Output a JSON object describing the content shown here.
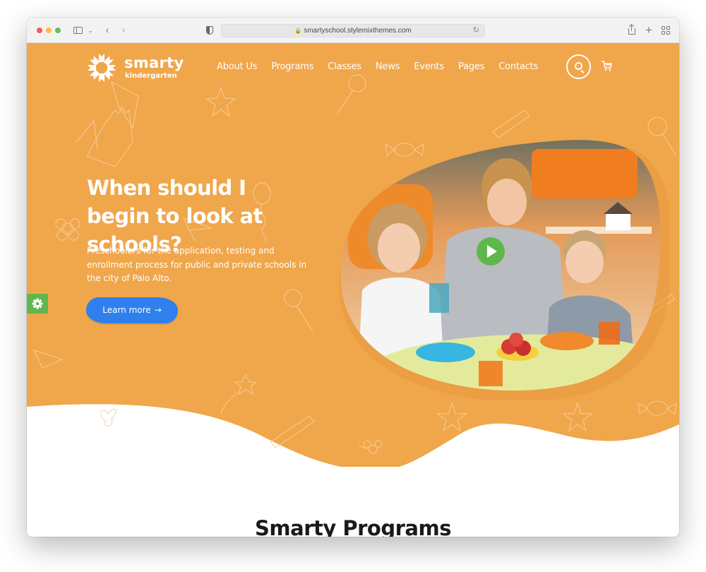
{
  "browser": {
    "url": "smartyschool.stylemixthemes.com",
    "icons": [
      "sidebar-icon",
      "chevron-down-icon",
      "back-icon",
      "forward-icon",
      "privacy-shield-icon",
      "lock-icon",
      "reload-icon",
      "share-icon",
      "new-tab-icon",
      "tab-overview-icon"
    ]
  },
  "site": {
    "logo": {
      "title": "smarty",
      "subtitle": "kindergarten"
    },
    "nav": [
      {
        "label": "About Us"
      },
      {
        "label": "Programs"
      },
      {
        "label": "Classes"
      },
      {
        "label": "News"
      },
      {
        "label": "Events"
      },
      {
        "label": "Pages"
      },
      {
        "label": "Contacts"
      }
    ],
    "header_icons": [
      "search-icon",
      "cart-icon"
    ],
    "hero": {
      "headline": "When should I begin to look at schools?",
      "description": "Preschoolers for the application, testing and enrollment process for public and private schools in the city of Palo Alto.",
      "cta_label": "Learn more",
      "cta_arrow": "→",
      "media": "video-thumbnail-teacher-with-children"
    },
    "section_title": "Smarty Programs"
  },
  "colors": {
    "brand_orange": "#f0a64a",
    "cta_blue": "#2f80ed",
    "accent_green": "#5fb74c"
  }
}
